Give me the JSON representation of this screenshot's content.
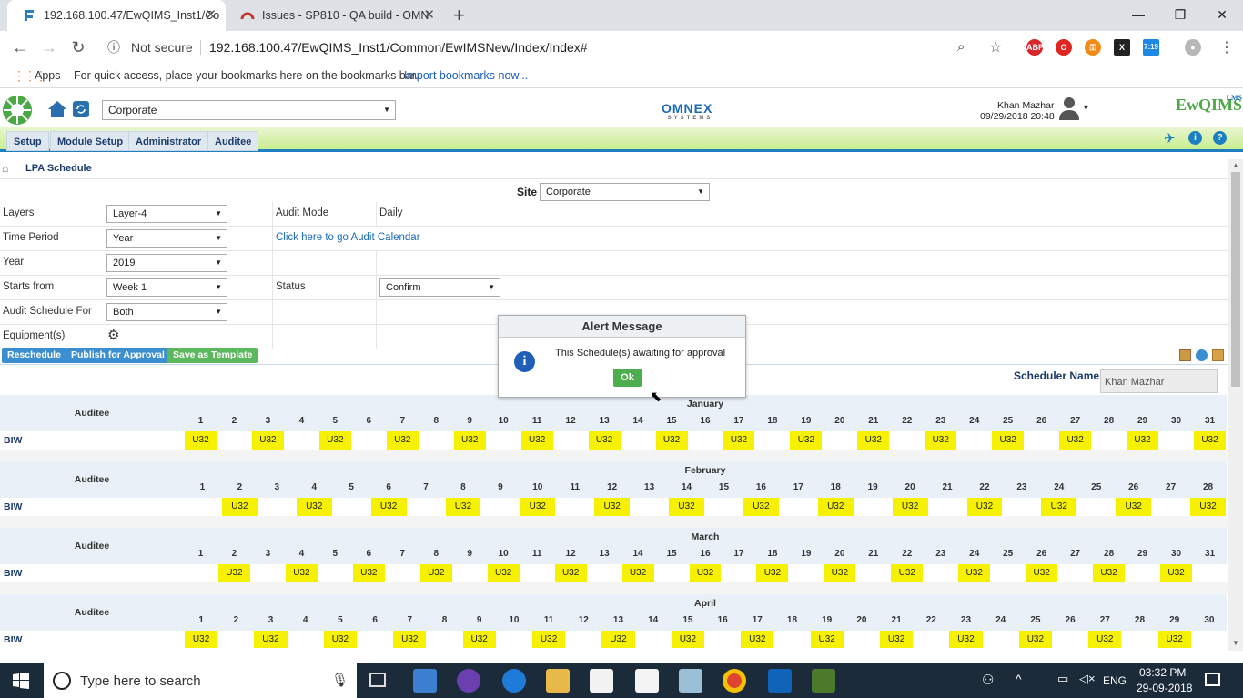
{
  "browser": {
    "tabs": [
      {
        "title": "192.168.100.47/EwQIMS_Inst1/Co",
        "active": true
      },
      {
        "title": "Issues - SP810 - QA build - OMN",
        "active": false
      }
    ],
    "new_tab": "+",
    "win_minimize": "—",
    "win_restore": "❐",
    "win_close": "✕",
    "security": "Not secure",
    "url": "192.168.100.47/EwQIMS_Inst1/Common/EwIMSNew/Index/Index#",
    "ext_badge": "7:19",
    "bookmarks": {
      "apps": "Apps",
      "hint": "For quick access, place your bookmarks here on the bookmarks bar.",
      "import": "Import bookmarks now..."
    }
  },
  "app": {
    "company_select": "Corporate",
    "brand_center": "OMNEX",
    "brand_center_sub": "SYSTEMS",
    "user_name": "Khan Mazhar",
    "user_datetime": "09/29/2018 20:48",
    "brand_right": "EwQIMS",
    "brand_right_sup": "LMS",
    "menu": [
      "Setup",
      "Module Setup",
      "Administrator",
      "Auditee"
    ],
    "breadcrumb": "LPA Schedule"
  },
  "form": {
    "site_label": "Site",
    "site_value": "Corporate",
    "layers_label": "Layers",
    "layers_value": "Layer-4",
    "audit_mode_label": "Audit Mode",
    "audit_mode_value": "Daily",
    "time_period_label": "Time Period",
    "time_period_value": "Year",
    "calendar_link": "Click here to go Audit Calendar",
    "year_label": "Year",
    "year_value": "2019",
    "starts_from_label": "Starts from",
    "starts_from_value": "Week 1",
    "status_label": "Status",
    "status_value": "Confirm",
    "audit_for_label": "Audit Schedule For",
    "audit_for_value": "Both",
    "equipment_label": "Equipment(s)"
  },
  "actions": {
    "reschedule": "Reschedule",
    "publish": "Publish for Approval",
    "template": "Save as Template"
  },
  "scheduler": {
    "label": "Scheduler Name",
    "value": "Khan   Mazhar"
  },
  "schedule": {
    "auditee_header": "Auditee",
    "row_label": "BIW",
    "cell_text": "U32",
    "months": [
      {
        "name": "January",
        "days": 31,
        "marked": [
          1,
          3,
          5,
          7,
          9,
          11,
          13,
          15,
          17,
          19,
          21,
          23,
          25,
          27,
          29,
          31
        ]
      },
      {
        "name": "February",
        "days": 28,
        "marked": [
          2,
          4,
          6,
          8,
          10,
          12,
          14,
          16,
          18,
          20,
          22,
          24,
          26,
          28
        ]
      },
      {
        "name": "March",
        "days": 31,
        "marked": [
          2,
          4,
          6,
          8,
          10,
          12,
          14,
          16,
          18,
          20,
          22,
          24,
          26,
          28,
          30
        ]
      },
      {
        "name": "April",
        "days": 30,
        "marked": [
          1,
          3,
          5,
          7,
          9,
          11,
          13,
          15,
          17,
          19,
          21,
          23,
          25,
          27,
          29
        ]
      }
    ]
  },
  "modal": {
    "title": "Alert Message",
    "message": "This Schedule(s) awaiting for approval",
    "ok": "Ok"
  },
  "taskbar": {
    "search_placeholder": "Type here to search",
    "lang": "ENG",
    "time": "03:32 PM",
    "date": "29-09-2018"
  },
  "colors": {
    "menu_gradient": "#c9ee8f",
    "button_blue": "#3b8ed0",
    "button_green": "#5cb85c",
    "schedule_yellow": "#f5f100",
    "header_blue": "#1e7fc0"
  }
}
